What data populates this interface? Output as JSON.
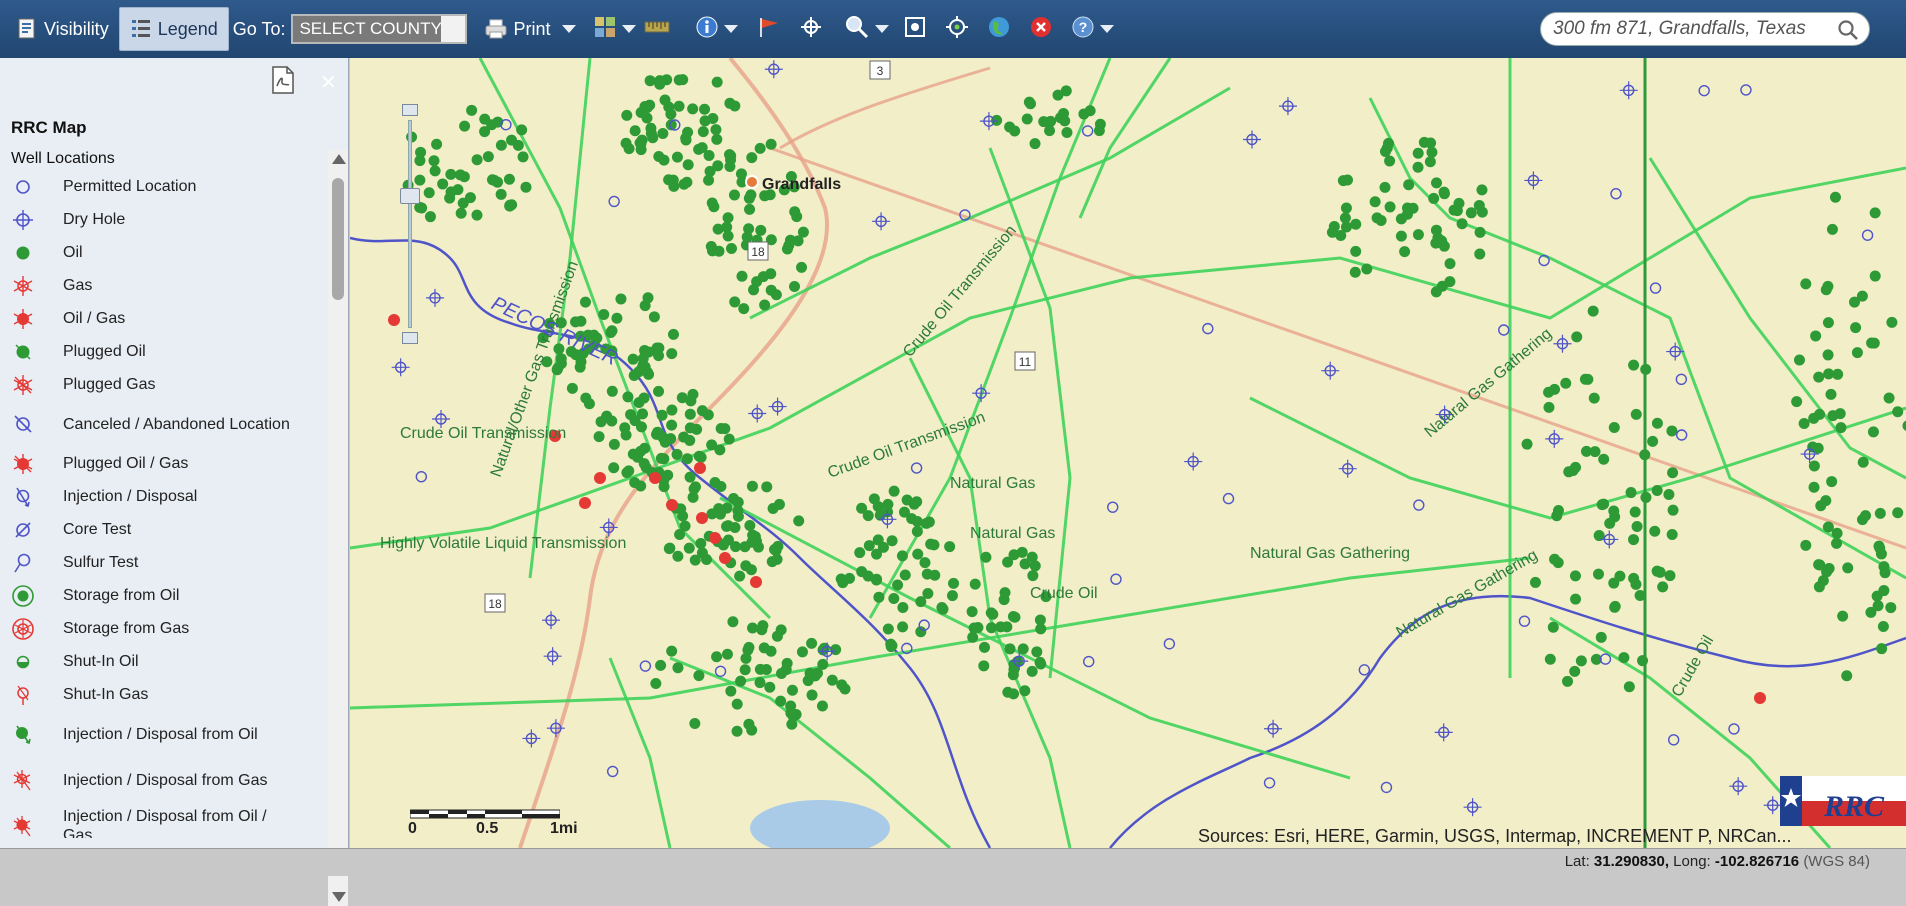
{
  "toolbar": {
    "visibility_label": "Visibility",
    "legend_label": "Legend",
    "goto_label": "Go To:",
    "county_value": "SELECT COUNTY",
    "print_label": "Print",
    "search_placeholder": "300 fm 871, Grandfalls, Texas"
  },
  "sidebar": {
    "map_title": "RRC Map",
    "section_title": "Well Locations",
    "items": [
      {
        "label": "Permitted Location",
        "symbol": "open-blue-circle"
      },
      {
        "label": "Dry Hole",
        "symbol": "blue-circle-crosshair"
      },
      {
        "label": "Oil",
        "symbol": "green-dot"
      },
      {
        "label": "Gas",
        "symbol": "red-star-open"
      },
      {
        "label": "Oil / Gas",
        "symbol": "red-star-filled"
      },
      {
        "label": "Plugged Oil",
        "symbol": "green-dot-slash"
      },
      {
        "label": "Plugged Gas",
        "symbol": "red-star-open-slash"
      },
      {
        "label": "Canceled / Abandoned Location",
        "symbol": "blue-circle-slash"
      },
      {
        "label": "Plugged Oil / Gas",
        "symbol": "red-star-filled-slash"
      },
      {
        "label": "Injection / Disposal",
        "symbol": "blue-circle-arrow"
      },
      {
        "label": "Core Test",
        "symbol": "blue-circle-diag"
      },
      {
        "label": "Sulfur Test",
        "symbol": "blue-circle-tail"
      },
      {
        "label": "Storage from Oil",
        "symbol": "green-ring"
      },
      {
        "label": "Storage from Gas",
        "symbol": "red-ring"
      },
      {
        "label": "Shut-In Oil",
        "symbol": "green-half"
      },
      {
        "label": "Shut-In Gas",
        "symbol": "red-open-stem"
      },
      {
        "label": "Injection / Disposal from Oil",
        "symbol": "green-dot-arrow"
      },
      {
        "label": "Injection / Disposal from Gas",
        "symbol": "red-star-arrow"
      },
      {
        "label": "Injection / Disposal from Oil / Gas",
        "symbol": "red-star-filled-arrow"
      }
    ]
  },
  "map": {
    "town": "Grandfalls",
    "river_label": "PECOS RIVER",
    "pipeline_labels": [
      "Natural Gas Gathering",
      "Natural/Other Gas Transmission",
      "Crude Oil Transmission",
      "Highly Volatile Liquid Transmission",
      "Natural Gas",
      "Crude Oil"
    ],
    "highway_shields": [
      "11",
      "18",
      "18",
      "3"
    ],
    "scale_labels": [
      "0",
      "0.5",
      "1mi"
    ],
    "attribution": "Sources: Esri, HERE, Garmin, USGS, Intermap, INCREMENT P, NRCan...",
    "colors": {
      "oil": "#2e9a35",
      "gas": "#e53935",
      "permitted": "#4f54c9",
      "pipeline": "#3fd15a",
      "base": "#f1eec8"
    }
  },
  "status": {
    "lat_label": "Lat:",
    "lat_value": "31.290830,",
    "long_label": "Long:",
    "long_value": "-102.826716",
    "datum": "(WGS 84)"
  }
}
